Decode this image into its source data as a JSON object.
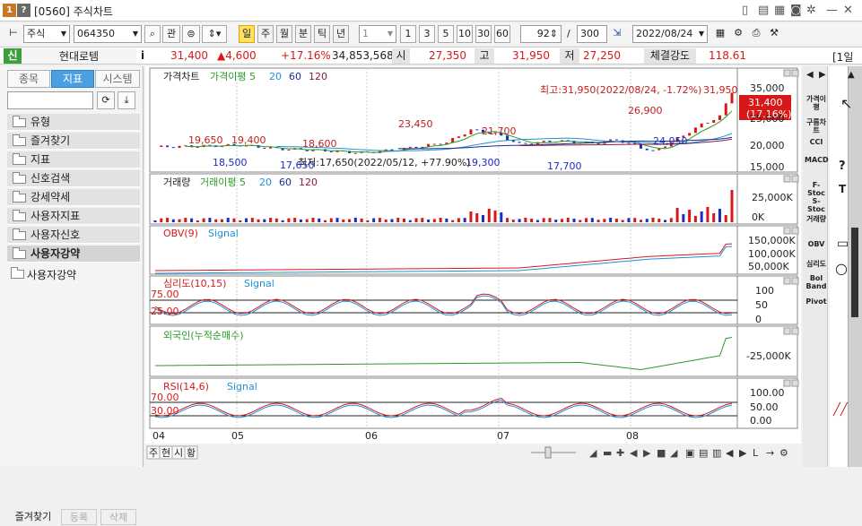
{
  "window": {
    "id": "[0560]",
    "title": "주식차트"
  },
  "toolbar": {
    "market": "주식",
    "code": "064350",
    "search_btn": "관",
    "periods": [
      "일",
      "주",
      "월",
      "분",
      "틱",
      "년"
    ],
    "interval": "1",
    "nums": [
      "1",
      "3",
      "5",
      "10",
      "30",
      "60"
    ],
    "count": "92",
    "separator": "/",
    "total": "300",
    "date": "2022/08/24"
  },
  "quote": {
    "badge": "신",
    "name": "현대로템",
    "info": "i",
    "price": "31,400",
    "change": "▲4,600",
    "pct": "+17.16%",
    "volume": "34,853,568",
    "open_label": "시",
    "open": "27,350",
    "high_label": "고",
    "high": "31,950",
    "low_label": "저",
    "low": "27,250",
    "strength_label": "체결강도",
    "strength": "118.61",
    "extra": "[1일"
  },
  "left": {
    "tabs": [
      "종목",
      "지표",
      "시스템"
    ],
    "items": [
      "유형",
      "즐겨찾기",
      "지표",
      "신호검색",
      "강세약세",
      "사용자지표",
      "사용자신호",
      "사용자강약"
    ],
    "last": "사용자강약",
    "bottom": [
      "즐겨찾기",
      "등록",
      "삭제"
    ]
  },
  "panels": {
    "price": {
      "title": "가격차트",
      "ma_label": "가격이평 5",
      "ma2": "20",
      "ma3": "60",
      "ma4": "120",
      "max_note": "최고:31,950(2022/08/24, -1.72%)",
      "min_note": "최저:17,650(2022/05/12, +77.90%)",
      "labels": [
        "19,650",
        "19,400",
        "18,600",
        "18,500",
        "17,650",
        "23,450",
        "21,700",
        "17,700",
        "26,900",
        "24,050",
        "31,950",
        "19,300"
      ],
      "yticks": [
        "35,000",
        "25,000",
        "20,000",
        "15,000"
      ],
      "current": "31,400",
      "current_pct": "(17.16%)"
    },
    "volume": {
      "title": "거래량",
      "ma_label": "거래이평 5",
      "ma2": "20",
      "ma3": "60",
      "ma4": "120",
      "yticks": [
        "25,000K",
        "0K"
      ]
    },
    "obv": {
      "title": "OBV(9)",
      "signal": "Signal",
      "yticks": [
        "150,000K",
        "100,000K",
        "50,000K"
      ]
    },
    "psy": {
      "title": "심리도(10,15)",
      "signal": "Signal",
      "hi": "75.00",
      "lo": "25.00",
      "yticks": [
        "100",
        "50",
        "0"
      ]
    },
    "foreign": {
      "title": "외국인(누적순매수)",
      "yticks": [
        "-25,000K"
      ]
    },
    "rsi": {
      "title": "RSI(14,6)",
      "signal": "Signal",
      "hi": "70.00",
      "lo": "30.00",
      "yticks": [
        "100.00",
        "50.00",
        "0.00"
      ]
    }
  },
  "xaxis": [
    "04",
    "05",
    "06",
    "07",
    "08"
  ],
  "bottom_tabs": [
    "주",
    "현",
    "시",
    "황"
  ],
  "indicators": [
    "가격이평",
    "구름차트",
    "CCI",
    "MACD",
    "F-Stoc",
    "S-Stoc",
    "거래량",
    "OBV",
    "심리도",
    "Bol Band",
    "Pivot"
  ],
  "colors": {
    "up": "#d81818",
    "down": "#1c2cc8",
    "ma5": "#2a9a2a",
    "ma20": "#2090d8",
    "accent": "#ffe066"
  }
}
